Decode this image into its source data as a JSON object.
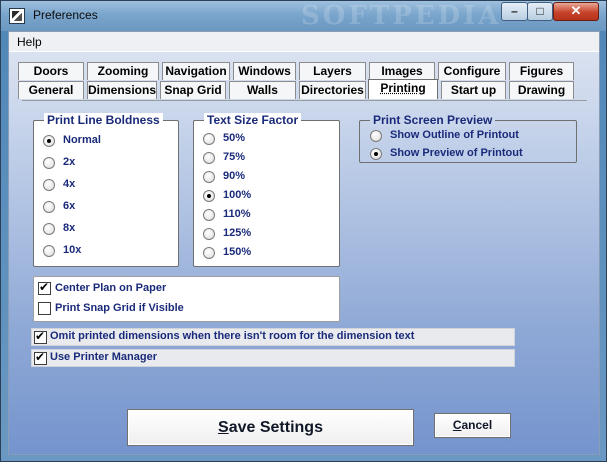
{
  "window": {
    "title": "Preferences",
    "watermark": "SOFTPEDIA",
    "controls": {
      "minimize": "–",
      "maximize": "□",
      "close": "✕"
    }
  },
  "menu": {
    "help": "Help"
  },
  "tabs": {
    "row1": [
      "Doors",
      "Zooming",
      "Navigation",
      "Windows",
      "Layers",
      "Images",
      "Configure",
      "Figures"
    ],
    "row2": [
      "General",
      "Dimensions",
      "Snap Grid",
      "Walls",
      "Directories",
      "Printing",
      "Start up",
      "Drawing"
    ],
    "active": "Printing"
  },
  "print_line_boldness": {
    "title": "Print Line Boldness",
    "options": [
      "Normal",
      "2x",
      "4x",
      "6x",
      "8x",
      "10x"
    ],
    "selected": "Normal"
  },
  "text_size_factor": {
    "title": "Text Size Factor",
    "options": [
      "50%",
      "75%",
      "90%",
      "100%",
      "110%",
      "125%",
      "150%"
    ],
    "selected": "100%"
  },
  "print_screen_preview": {
    "title": "Print Screen Preview",
    "options": [
      "Show Outline of Printout",
      "Show  Preview of Printout"
    ],
    "selected": "Show  Preview of Printout"
  },
  "checks": {
    "center_plan": {
      "label": "Center Plan on Paper",
      "checked": true
    },
    "print_snap_grid": {
      "label": "Print Snap Grid if Visible",
      "checked": false
    },
    "omit_dimensions": {
      "label": "Omit printed dimensions when there isn't room for the dimension text",
      "checked": true
    },
    "use_printer_manager": {
      "label": "Use Printer Manager",
      "checked": true
    }
  },
  "buttons": {
    "save_first": "S",
    "save_rest": "ave Settings",
    "cancel_first": "C",
    "cancel_rest": "ancel"
  }
}
